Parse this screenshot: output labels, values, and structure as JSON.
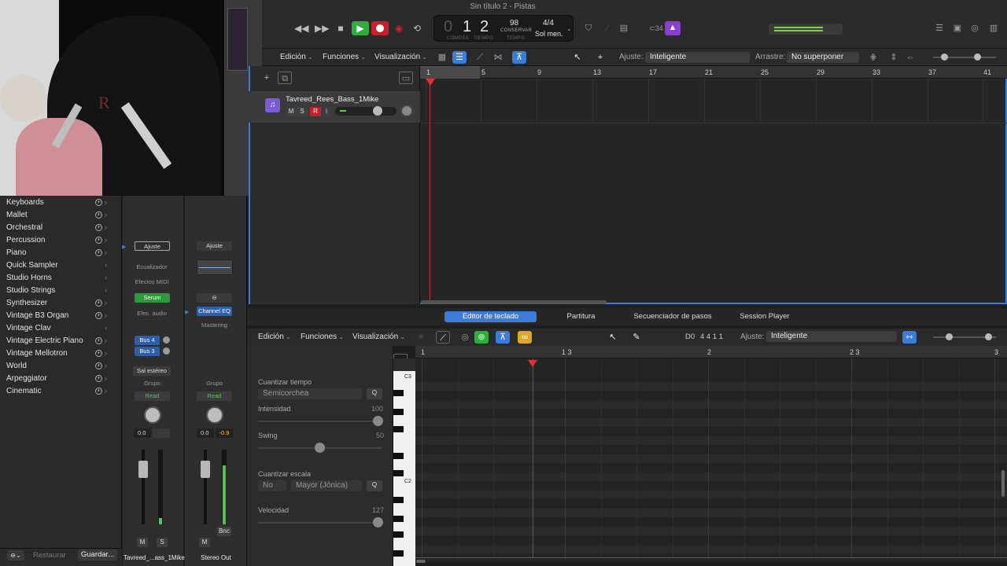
{
  "window": {
    "title": "Sin título 2 - Pistas"
  },
  "transport": {
    "rewind": "◀◀",
    "forward": "▶▶",
    "stop": "■",
    "play": "▶",
    "lcd": {
      "bar": "1",
      "beat": "2",
      "bar_label": "COMPÁS",
      "beat_label": "TIEMPO",
      "tempo": "98",
      "tempo_mode": "CONSERVAR",
      "tempo_label": "TEMPO",
      "signature": "4/4",
      "key": "Sol men."
    },
    "count_in": "⊂34"
  },
  "tracks_toolbar": {
    "edit_menu": "Edición",
    "functions_menu": "Funciones",
    "view_menu": "Visualización",
    "snap_label": "Ajuste:",
    "snap_value": "Inteligente",
    "drag_label": "Arrastre:",
    "drag_value": "No superponer"
  },
  "ruler_bars": [
    "1",
    "5",
    "9",
    "13",
    "17",
    "21",
    "25",
    "29",
    "33",
    "37",
    "41"
  ],
  "track": {
    "name": "Tavreed_Rees_Bass_1Mike",
    "mute": "M",
    "solo": "S",
    "record": "R"
  },
  "library": {
    "items": [
      {
        "label": "Keyboards",
        "plus": true
      },
      {
        "label": "Mallet",
        "plus": true
      },
      {
        "label": "Orchestral",
        "plus": true
      },
      {
        "label": "Percussion",
        "plus": true
      },
      {
        "label": "Piano",
        "plus": true
      },
      {
        "label": "Quick Sampler",
        "plus": false
      },
      {
        "label": "Studio Horns",
        "plus": false
      },
      {
        "label": "Studio Strings",
        "plus": false
      },
      {
        "label": "Synthesizer",
        "plus": true
      },
      {
        "label": "Vintage B3 Organ",
        "plus": true
      },
      {
        "label": "Vintage Clav",
        "plus": false
      },
      {
        "label": "Vintage Electric Piano",
        "plus": true
      },
      {
        "label": "Vintage Mellotron",
        "plus": true
      },
      {
        "label": "World",
        "plus": true
      },
      {
        "label": "Arpeggiator",
        "plus": true
      },
      {
        "label": "Cinematic",
        "plus": true
      }
    ],
    "restore": "Restaurar",
    "save": "Guardar..."
  },
  "strip1": {
    "setting": "Ajuste",
    "eq": "Ecualizador",
    "midi_fx": "Efectos MIDI",
    "instrument": "Serum",
    "audio_fx": "Efec. audio",
    "sends": [
      "Bus 4",
      "Bus 3"
    ],
    "output": "Sal estéreo",
    "group": "Grupo",
    "automation": "Read",
    "pan_value": "0.0",
    "mute": "M",
    "solo": "S",
    "name": "Tavreed_...ass_1Mike"
  },
  "strip2": {
    "setting": "Ajuste",
    "eq_plugin": "Channel EQ",
    "mastering": "Mastering",
    "group": "Grupo",
    "automation": "Read",
    "pan_value": "0.0",
    "peak": "-0.9",
    "mute": "M",
    "bounce": "Bnc",
    "name": "Stereo Out"
  },
  "editor_tabs": [
    "Editor de teclado",
    "Partitura",
    "Secuenciador de pasos",
    "Session Player"
  ],
  "editor_toolbar": {
    "edit_menu": "Edición",
    "functions_menu": "Funciones",
    "view_menu": "Visualización",
    "note": "D0",
    "position": "4 4 1 1",
    "snap_label": "Ajuste:",
    "snap_value": "Inteligente"
  },
  "quantize": {
    "time_label": "Cuantizar tiempo",
    "time_value": "Semicorchea",
    "q_button": "Q",
    "strength_label": "Intensidad",
    "strength_value": "100",
    "swing_label": "Swing",
    "swing_value": "50",
    "scale_label": "Cuantizar escala",
    "scale_mode": "No",
    "scale_value": "Mayor (Jónica)",
    "velocity_label": "Velocidad",
    "velocity_value": "127"
  },
  "piano_ruler": [
    "1",
    "1 3",
    "2",
    "2 3",
    "3"
  ],
  "piano_keys": [
    "C3",
    "C2"
  ],
  "colors": {
    "accent": "#3d7bd9",
    "play": "#2eae3c",
    "record": "#c8202c",
    "playhead": "#c53030",
    "serum": "#2c9a3a"
  }
}
